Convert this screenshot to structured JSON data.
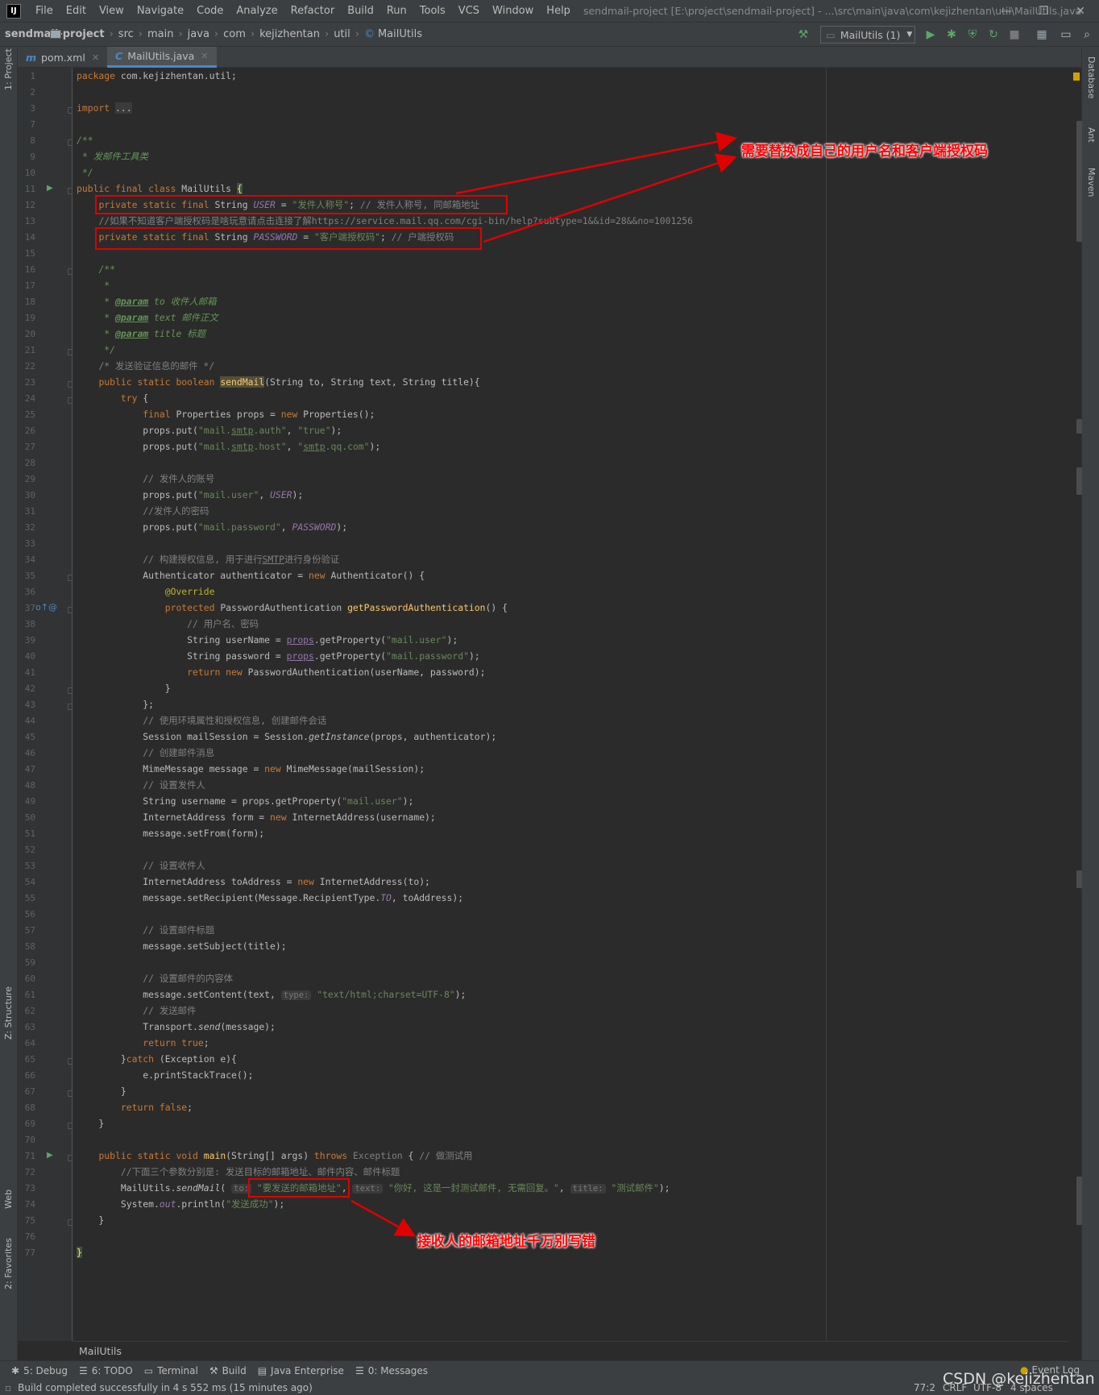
{
  "menubar": {
    "logo": "IJ",
    "items": [
      "File",
      "Edit",
      "View",
      "Navigate",
      "Code",
      "Analyze",
      "Refactor",
      "Build",
      "Run",
      "Tools",
      "VCS",
      "Window",
      "Help"
    ],
    "title": "sendmail-project [E:\\project\\sendmail-project] - ...\\src\\main\\java\\com\\kejizhentan\\util\\MailUtils.java"
  },
  "navbar": {
    "project": "sendmail-project",
    "crumbs": [
      "src",
      "main",
      "java",
      "com",
      "kejizhentan",
      "util",
      "MailUtils"
    ],
    "run_config": "MailUtils (1)"
  },
  "tabs": [
    {
      "label": "pom.xml",
      "icon": "m",
      "active": false
    },
    {
      "label": "MailUtils.java",
      "icon": "C",
      "active": true
    }
  ],
  "left_strip": [
    "1: Project",
    "Z: Structure",
    "Web",
    "2: Favorites"
  ],
  "right_strip": [
    "Database",
    "Ant",
    "Maven"
  ],
  "code_lines": [
    {
      "n": 1,
      "t": "<span class='k'>package</span> com.kejizhentan.util;"
    },
    {
      "n": 2,
      "t": ""
    },
    {
      "n": 3,
      "t": "<span class='k'>import</span> <span style='background:#3b3b3b'>...</span>"
    },
    {
      "n": 7,
      "t": ""
    },
    {
      "n": 8,
      "t": "<span class='d'>/**</span>"
    },
    {
      "n": 9,
      "t": "<span class='d'> * 发邮件工具类</span>"
    },
    {
      "n": 10,
      "t": "<span class='d'> */</span>"
    },
    {
      "n": 11,
      "t": "<span class='k'>public final class</span> MailUtils <span style='background:#3b514d;color:#ffef28'>{</span>"
    },
    {
      "n": 12,
      "t": "    <span class='k'>private static final</span> String <span class='f'>USER</span> = <span class='s'>\"发件人称号\"</span>; <span class='c'>// 发件人称号, 同邮箱地址</span>"
    },
    {
      "n": 13,
      "t": "    <span class='c'>//如果不知道客户端授权码是啥玩意请点击连接了解https://service.mail.qq.com/cgi-bin/help?subtype=1&&id=28&&no=1001256</span>"
    },
    {
      "n": 14,
      "t": "    <span class='k'>private static final</span> String <span class='f'>PASSWORD</span> = <span class='s'>\"客户端授权码\"</span>; <span class='c'>// 户端授权码</span>"
    },
    {
      "n": 15,
      "t": ""
    },
    {
      "n": 16,
      "t": "    <span class='d'>/**</span>"
    },
    {
      "n": 17,
      "t": "<span class='d'>     *</span>"
    },
    {
      "n": 18,
      "t": "<span class='d'>     * </span><span class='dt'>@param</span><span class='d'> to 收件人邮箱</span>"
    },
    {
      "n": 19,
      "t": "<span class='d'>     * </span><span class='dt'>@param</span><span class='d'> text 邮件正文</span>"
    },
    {
      "n": 20,
      "t": "<span class='d'>     * </span><span class='dt'>@param</span><span class='d'> title 标题</span>"
    },
    {
      "n": 21,
      "t": "<span class='d'>     */</span>"
    },
    {
      "n": 22,
      "t": "    <span class='c'>/* 发送验证信息的邮件 */</span>"
    },
    {
      "n": 23,
      "t": "    <span class='k'>public static boolean</span> <span class='m' style='background:#52503a'>sendMail</span>(String to, String text, String title){"
    },
    {
      "n": 24,
      "t": "        <span class='k'>try</span> {"
    },
    {
      "n": 25,
      "t": "            <span class='k'>final</span> Properties props = <span class='k'>new</span> Properties();"
    },
    {
      "n": 26,
      "t": "            props.put(<span class='s'>\"mail.<span class='u'>smtp</span>.auth\"</span>, <span class='s'>\"true\"</span>);"
    },
    {
      "n": 27,
      "t": "            props.put(<span class='s'>\"mail.<span class='u'>smtp</span>.host\"</span>, <span class='s'>\"<span class='u'>smtp</span>.qq.com\"</span>);"
    },
    {
      "n": 28,
      "t": ""
    },
    {
      "n": 29,
      "t": "            <span class='c'>// 发件人的账号</span>"
    },
    {
      "n": 30,
      "t": "            props.put(<span class='s'>\"mail.user\"</span>, <span class='f'>USER</span>);"
    },
    {
      "n": 31,
      "t": "            <span class='c'>//发件人的密码</span>"
    },
    {
      "n": 32,
      "t": "            props.put(<span class='s'>\"mail.password\"</span>, <span class='f'>PASSWORD</span>);"
    },
    {
      "n": 33,
      "t": ""
    },
    {
      "n": 34,
      "t": "            <span class='c'>// 构建授权信息, 用于进行<span class='u'>SMTP</span>进行身份验证</span>"
    },
    {
      "n": 35,
      "t": "            Authenticator authenticator = <span class='k'>new</span> Authenticator() {"
    },
    {
      "n": 36,
      "t": "                <span class='a'>@Override</span>"
    },
    {
      "n": 37,
      "t": "                <span class='k'>protected</span> PasswordAuthentication <span class='m'>getPasswordAuthentication</span>() {"
    },
    {
      "n": 38,
      "t": "                    <span class='c'>// 用户名、密码</span>"
    },
    {
      "n": 39,
      "t": "                    String userName = <span class='f u' style='font-style:normal'>props</span>.getProperty(<span class='s'>\"mail.user\"</span>);"
    },
    {
      "n": 40,
      "t": "                    String password = <span class='f u' style='font-style:normal'>props</span>.getProperty(<span class='s'>\"mail.password\"</span>);"
    },
    {
      "n": 41,
      "t": "                    <span class='k'>return new</span> PasswordAuthentication(userName, password);"
    },
    {
      "n": 42,
      "t": "                }"
    },
    {
      "n": 43,
      "t": "            };"
    },
    {
      "n": 44,
      "t": "            <span class='c'>// 使用环境属性和授权信息, 创建邮件会话</span>"
    },
    {
      "n": 45,
      "t": "            Session mailSession = Session.<span class='it'>getInstance</span>(props, authenticator);"
    },
    {
      "n": 46,
      "t": "            <span class='c'>// 创建邮件消息</span>"
    },
    {
      "n": 47,
      "t": "            MimeMessage message = <span class='k'>new</span> MimeMessage(mailSession);"
    },
    {
      "n": 48,
      "t": "            <span class='c'>// 设置发件人</span>"
    },
    {
      "n": 49,
      "t": "            String username = props.getProperty(<span class='s'>\"mail.user\"</span>);"
    },
    {
      "n": 50,
      "t": "            InternetAddress form = <span class='k'>new</span> InternetAddress(username);"
    },
    {
      "n": 51,
      "t": "            message.setFrom(form);"
    },
    {
      "n": 52,
      "t": ""
    },
    {
      "n": 53,
      "t": "            <span class='c'>// 设置收件人</span>"
    },
    {
      "n": 54,
      "t": "            InternetAddress toAddress = <span class='k'>new</span> InternetAddress(to);"
    },
    {
      "n": 55,
      "t": "            message.setRecipient(Message.RecipientType.<span class='f'>TO</span>, toAddress);"
    },
    {
      "n": 56,
      "t": ""
    },
    {
      "n": 57,
      "t": "            <span class='c'>// 设置邮件标题</span>"
    },
    {
      "n": 58,
      "t": "            message.setSubject(title);"
    },
    {
      "n": 59,
      "t": ""
    },
    {
      "n": 60,
      "t": "            <span class='c'>// 设置邮件的内容体</span>"
    },
    {
      "n": 61,
      "t": "            message.setContent(text, <span class='hint'>type:</span> <span class='s'>\"text/html;charset=UTF-8\"</span>);"
    },
    {
      "n": 62,
      "t": "            <span class='c'>// 发送邮件</span>"
    },
    {
      "n": 63,
      "t": "            Transport.<span class='it'>send</span>(message);"
    },
    {
      "n": 64,
      "t": "            <span class='k'>return true</span>;"
    },
    {
      "n": 65,
      "t": "        }<span class='k'>catch</span> (Exception e){"
    },
    {
      "n": 66,
      "t": "            e.printStackTrace();"
    },
    {
      "n": 67,
      "t": "        }"
    },
    {
      "n": 68,
      "t": "        <span class='k'>return false</span>;"
    },
    {
      "n": 69,
      "t": "    }"
    },
    {
      "n": 70,
      "t": ""
    },
    {
      "n": 71,
      "t": "    <span class='k'>public static void</span> <span class='m'>main</span>(String[] args) <span class='k'>throws</span> <span style='color:#808080'>Exception</span> { <span class='c'>// 做测试用</span>"
    },
    {
      "n": 72,
      "t": "        <span class='c'>//下面三个参数分别是: 发送目标的邮箱地址、邮件内容、邮件标题</span>"
    },
    {
      "n": 73,
      "t": "        MailUtils.<span class='it'>sendMail</span>( <span class='hint'>to:</span> <span class='s'>\"要发送的邮箱地址\"</span>, <span class='hint'>text:</span> <span class='s'>\"你好, 这是一封测试邮件, 无需回复。\"</span>, <span class='hint'>title:</span> <span class='s'>\"测试邮件\"</span>);"
    },
    {
      "n": 74,
      "t": "        System.<span class='f'>out</span>.println(<span class='s'>\"发送成功\"</span>);"
    },
    {
      "n": 75,
      "t": "    }"
    },
    {
      "n": 76,
      "t": ""
    },
    {
      "n": 77,
      "t": "<span style='background:#3b514d;color:#ffef28'>}</span>"
    }
  ],
  "annotations": {
    "top": "需要替换成自己的用户名和客户端授权码",
    "bottom": "接收人的邮箱地址千万别写错"
  },
  "editor_breadcrumb": "MailUtils",
  "bottom_tabs": [
    {
      "glyph": "✱",
      "label": "5: Debug"
    },
    {
      "glyph": "☰",
      "label": "6: TODO"
    },
    {
      "glyph": "▭",
      "label": "Terminal"
    },
    {
      "glyph": "⚒",
      "label": "Build"
    },
    {
      "glyph": "▤",
      "label": "Java Enterprise"
    },
    {
      "glyph": "☰",
      "label": "0: Messages"
    }
  ],
  "event_log": "Event Log",
  "status": {
    "message": "Build completed successfully in 4 s 552 ms (15 minutes ago)",
    "position": "77:2",
    "line_sep": "CRLF",
    "encoding": "UTF-8",
    "indent": "4 spaces"
  },
  "watermark": "CSDN @kejizhentan",
  "colors": {
    "accent": "#4a88c7",
    "annotation": "#ff0000",
    "keyword": "#cc7832",
    "string": "#6a8759"
  }
}
